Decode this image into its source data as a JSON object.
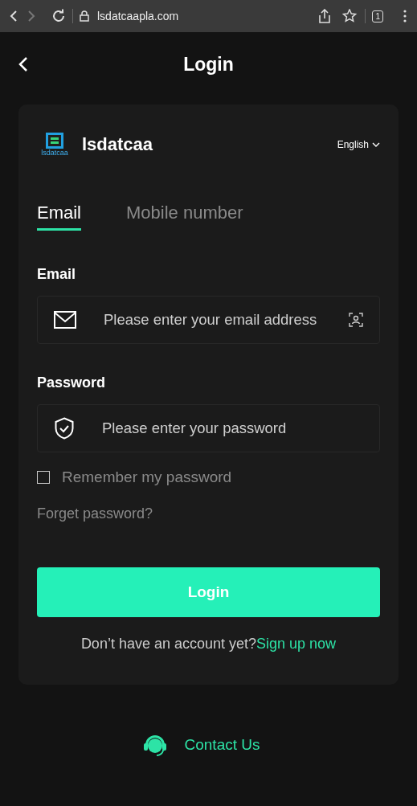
{
  "browser": {
    "url": "lsdatcaapla.com",
    "tab_count": "1"
  },
  "header": {
    "title": "Login"
  },
  "brand": {
    "logo_text": "lsdatcaa",
    "name": "lsdatcaa",
    "language": "English"
  },
  "tabs": [
    {
      "label": "Email",
      "selected": true
    },
    {
      "label": "Mobile number",
      "selected": false
    }
  ],
  "fields": [
    {
      "kind": "email",
      "label": "Email",
      "placeholder": "Please enter your email address"
    },
    {
      "kind": "password",
      "label": "Password",
      "placeholder": "Please enter your password"
    }
  ],
  "remember": {
    "label": "Remember my password",
    "checked": false
  },
  "forgot": "Forget password?",
  "login_button": "Login",
  "signup": {
    "prompt": "Don’t have an account yet?",
    "link": "Sign up now"
  },
  "contact": "Contact Us"
}
